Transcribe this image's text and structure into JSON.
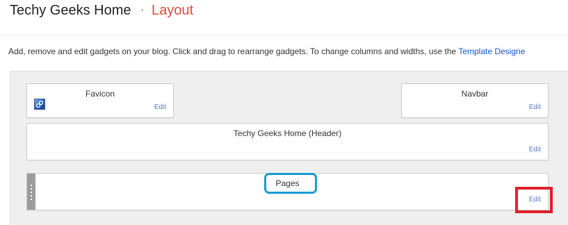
{
  "header": {
    "blog_title": "Techy Geeks Home",
    "separator": "·",
    "page_title": "Layout"
  },
  "description": {
    "text": "Add, remove and edit gadgets on your blog. Click and drag to rearrange gadgets. To change columns and widths, use the ",
    "link": "Template Designe"
  },
  "gadgets": {
    "favicon": {
      "title": "Favicon",
      "edit": "Edit",
      "icon": "favicon-image-icon"
    },
    "navbar": {
      "title": "Navbar",
      "edit": "Edit"
    },
    "header": {
      "title": "Techy Geeks Home (Header)",
      "edit": "Edit"
    },
    "pages": {
      "title": "Pages",
      "edit": "Edit",
      "icon": "drag-handle-icon"
    }
  },
  "colors": {
    "page_title": "#dd4b39",
    "link": "#1155cc",
    "edit_link": "#5a7cc0",
    "highlight_blue": "#1a9ad6",
    "highlight_red": "#e0202a",
    "layout_bg": "#efefef"
  }
}
